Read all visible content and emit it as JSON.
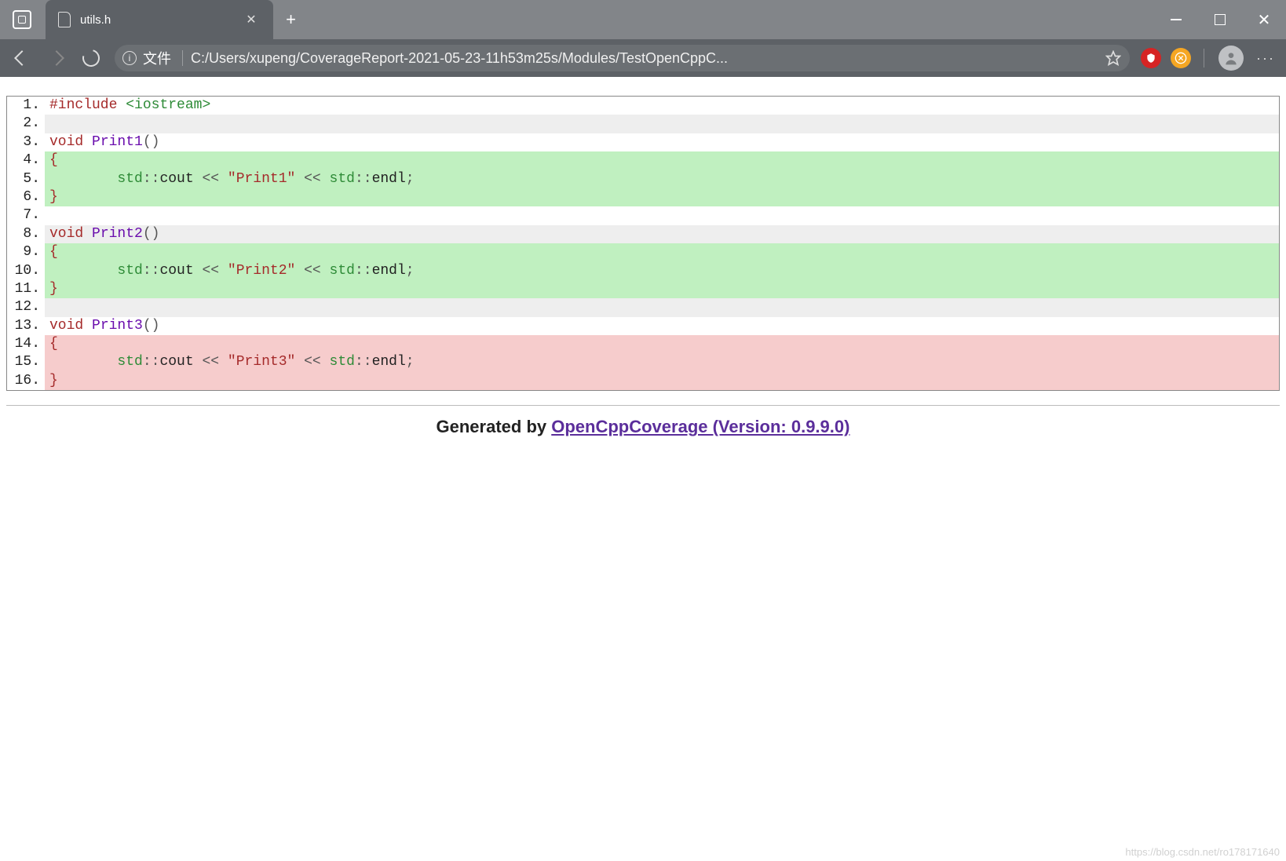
{
  "tab": {
    "title": "utils.h"
  },
  "addr": {
    "scheme": "文件",
    "path": "C:/Users/xupeng/CoverageReport-2021-05-23-11h53m25s/Modules/TestOpenCppC..."
  },
  "code": {
    "lines": [
      {
        "n": "1",
        "cov": "none",
        "parts": [
          [
            "kw-include",
            "#include"
          ],
          [
            "plain",
            " "
          ],
          [
            "kw-header",
            "<iostream>"
          ]
        ]
      },
      {
        "n": "2",
        "cov": "none",
        "parts": []
      },
      {
        "n": "3",
        "cov": "none",
        "parts": [
          [
            "kw-void",
            "void"
          ],
          [
            "plain",
            " "
          ],
          [
            "kw-fn",
            "Print1"
          ],
          [
            "kw-punct",
            "()"
          ]
        ]
      },
      {
        "n": "4",
        "cov": "covered",
        "parts": [
          [
            "kw-brace",
            "{"
          ]
        ]
      },
      {
        "n": "5",
        "cov": "covered",
        "parts": [
          [
            "plain",
            "        "
          ],
          [
            "kw-stdns",
            "std"
          ],
          [
            "kw-scope",
            "::"
          ],
          [
            "kw-ident",
            "cout"
          ],
          [
            "plain",
            " "
          ],
          [
            "kw-op",
            "<<"
          ],
          [
            "plain",
            " "
          ],
          [
            "kw-str",
            "\"Print1\""
          ],
          [
            "plain",
            " "
          ],
          [
            "kw-op",
            "<<"
          ],
          [
            "plain",
            " "
          ],
          [
            "kw-stdns",
            "std"
          ],
          [
            "kw-scope",
            "::"
          ],
          [
            "kw-ident",
            "endl"
          ],
          [
            "kw-punct",
            ";"
          ]
        ]
      },
      {
        "n": "6",
        "cov": "covered",
        "parts": [
          [
            "kw-brace",
            "}"
          ]
        ]
      },
      {
        "n": "7",
        "cov": "none",
        "parts": []
      },
      {
        "n": "8",
        "cov": "none",
        "parts": [
          [
            "kw-void",
            "void"
          ],
          [
            "plain",
            " "
          ],
          [
            "kw-fn",
            "Print2"
          ],
          [
            "kw-punct",
            "()"
          ]
        ]
      },
      {
        "n": "9",
        "cov": "covered",
        "parts": [
          [
            "kw-brace",
            "{"
          ]
        ]
      },
      {
        "n": "10",
        "cov": "covered",
        "parts": [
          [
            "plain",
            "        "
          ],
          [
            "kw-stdns",
            "std"
          ],
          [
            "kw-scope",
            "::"
          ],
          [
            "kw-ident",
            "cout"
          ],
          [
            "plain",
            " "
          ],
          [
            "kw-op",
            "<<"
          ],
          [
            "plain",
            " "
          ],
          [
            "kw-str",
            "\"Print2\""
          ],
          [
            "plain",
            " "
          ],
          [
            "kw-op",
            "<<"
          ],
          [
            "plain",
            " "
          ],
          [
            "kw-stdns",
            "std"
          ],
          [
            "kw-scope",
            "::"
          ],
          [
            "kw-ident",
            "endl"
          ],
          [
            "kw-punct",
            ";"
          ]
        ]
      },
      {
        "n": "11",
        "cov": "covered",
        "parts": [
          [
            "kw-brace",
            "}"
          ]
        ]
      },
      {
        "n": "12",
        "cov": "none",
        "parts": []
      },
      {
        "n": "13",
        "cov": "none",
        "parts": [
          [
            "kw-void",
            "void"
          ],
          [
            "plain",
            " "
          ],
          [
            "kw-fn",
            "Print3"
          ],
          [
            "kw-punct",
            "()"
          ]
        ]
      },
      {
        "n": "14",
        "cov": "uncovered",
        "parts": [
          [
            "kw-brace",
            "{"
          ]
        ]
      },
      {
        "n": "15",
        "cov": "uncovered",
        "parts": [
          [
            "plain",
            "        "
          ],
          [
            "kw-stdns",
            "std"
          ],
          [
            "kw-scope",
            "::"
          ],
          [
            "kw-ident",
            "cout"
          ],
          [
            "plain",
            " "
          ],
          [
            "kw-op",
            "<<"
          ],
          [
            "plain",
            " "
          ],
          [
            "kw-str",
            "\"Print3\""
          ],
          [
            "plain",
            " "
          ],
          [
            "kw-op",
            "<<"
          ],
          [
            "plain",
            " "
          ],
          [
            "kw-stdns",
            "std"
          ],
          [
            "kw-scope",
            "::"
          ],
          [
            "kw-ident",
            "endl"
          ],
          [
            "kw-punct",
            ";"
          ]
        ]
      },
      {
        "n": "16",
        "cov": "uncovered",
        "parts": [
          [
            "kw-brace",
            "}"
          ]
        ]
      }
    ]
  },
  "footer": {
    "prefix": "Generated by ",
    "link_text": "OpenCppCoverage (Version: 0.9.9.0)"
  },
  "watermark": "https://blog.csdn.net/ro178171640"
}
